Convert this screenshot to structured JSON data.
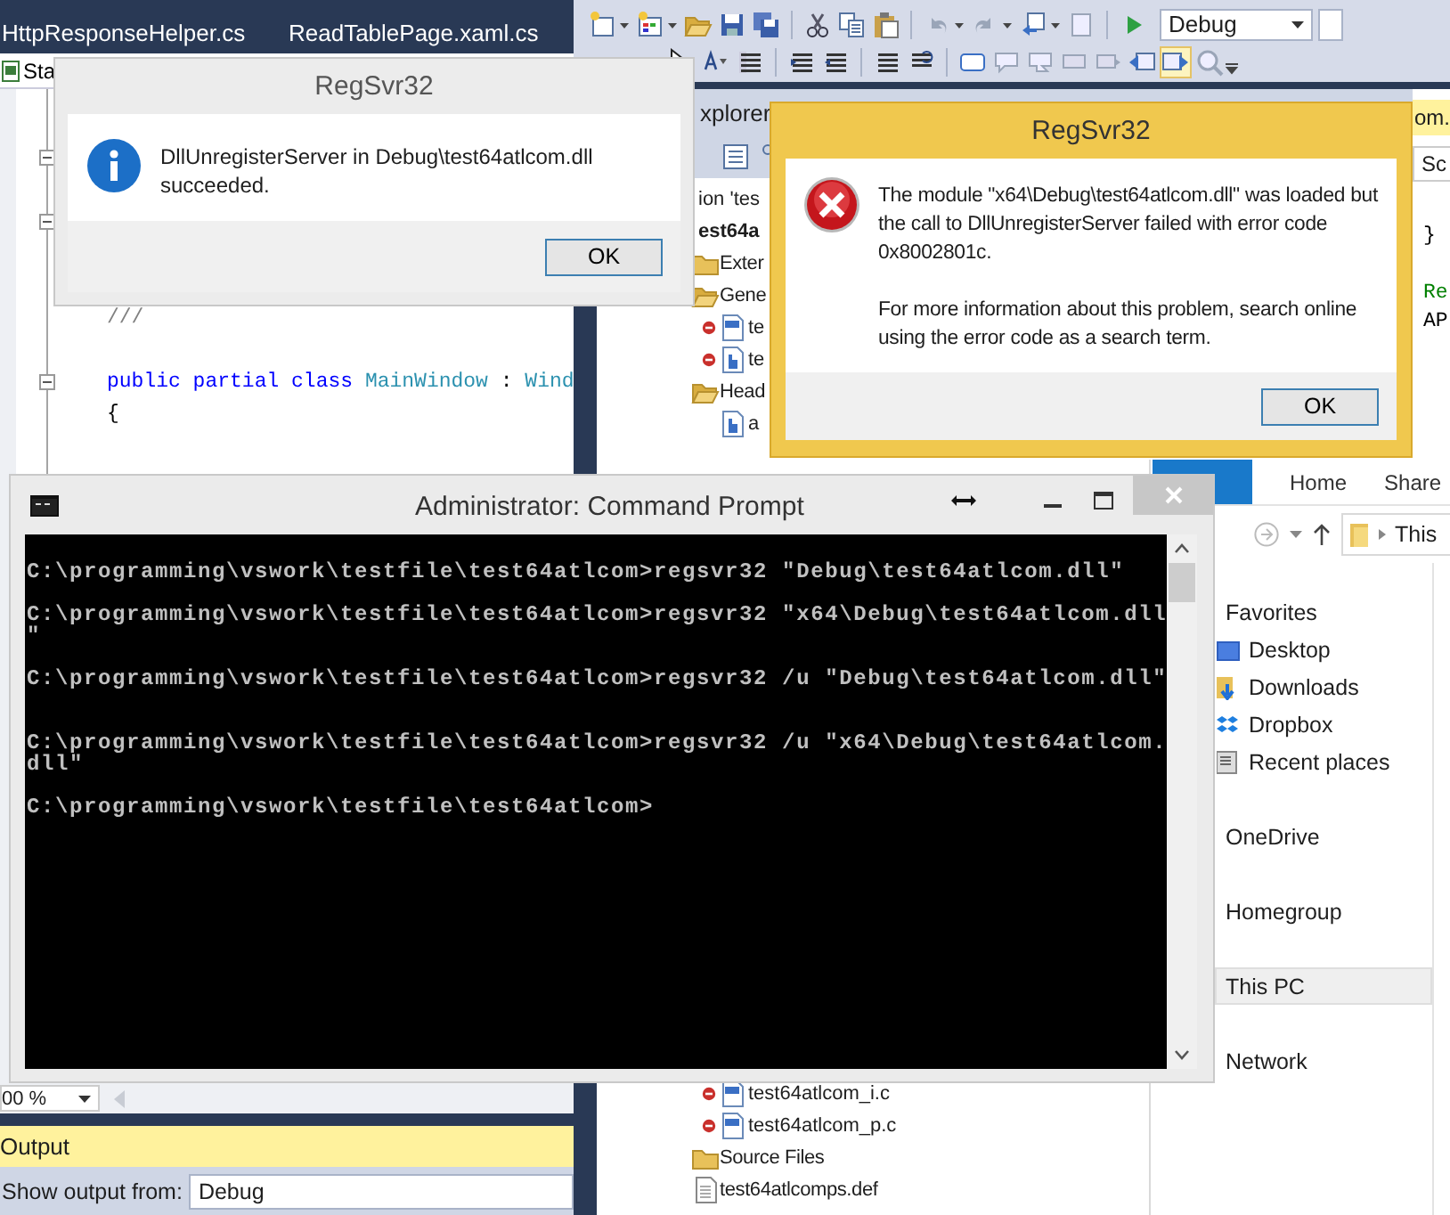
{
  "ide": {
    "editor_tabs": [
      {
        "label": "HttpResponseHelper.cs",
        "selected": false
      },
      {
        "label": "ReadTablePage.xaml.cs",
        "selected": false
      }
    ],
    "type_dropdown": {
      "value": "Sta"
    },
    "code_lines": [
      {
        "kind": "blank",
        "collapsible": false
      },
      {
        "kind": "blank",
        "collapsible": true
      },
      {
        "kind": "blank",
        "collapsible": false
      },
      {
        "kind": "blank",
        "collapsible": true
      },
      {
        "kind": "blank",
        "collapsible": false
      },
      {
        "kind": "blank",
        "collapsible": false
      },
      {
        "kind": "code",
        "collapsible": false,
        "tokens": [
          {
            "text": "///",
            "kind": "comment"
          }
        ]
      },
      {
        "kind": "blank",
        "collapsible": false
      },
      {
        "kind": "code",
        "collapsible": true,
        "tokens": [
          {
            "text": "public partial class ",
            "kind": "keyword"
          },
          {
            "text": "MainWindow",
            "kind": "type"
          },
          {
            "text": " : ",
            "kind": "plain"
          },
          {
            "text": "Wind",
            "kind": "type"
          }
        ]
      },
      {
        "kind": "code",
        "collapsible": false,
        "tokens": [
          {
            "text": "{",
            "kind": "plain"
          }
        ]
      }
    ],
    "configuration_dropdown": {
      "value": "Debug"
    },
    "solution_explorer": {
      "title": "xplorer",
      "tree": [
        {
          "label": "ion 'tes",
          "children": [
            {
              "label": "est64a",
              "kind": "project",
              "children": [
                {
                  "label": "Exter",
                  "kind": "folder",
                  "expanded": false
                },
                {
                  "label": "Gene",
                  "kind": "folder",
                  "expanded": true,
                  "children": [
                    {
                      "label": "te",
                      "kind": "cpp",
                      "excluded": true
                    },
                    {
                      "label": "te",
                      "kind": "header",
                      "excluded": true
                    }
                  ]
                },
                {
                  "label": "Head",
                  "kind": "folder",
                  "expanded": true,
                  "children": [
                    {
                      "label": "a",
                      "kind": "header",
                      "excluded": false
                    }
                  ]
                }
              ]
            }
          ]
        }
      ],
      "continued_items": [
        {
          "label": "test64atlcom_i.c",
          "kind": "cpp",
          "excluded": true
        },
        {
          "label": "test64atlcom_p.c",
          "kind": "cpp",
          "excluded": true
        },
        {
          "label": "Source Files",
          "kind": "folder",
          "expanded": false
        },
        {
          "label": "test64atlcomps.def",
          "kind": "file",
          "excluded": false
        }
      ]
    },
    "right_editor": {
      "tab": "om.",
      "dropdown": "Sc",
      "lines": [
        {
          "kind": "blank"
        },
        {
          "kind": "code",
          "text": "}"
        },
        {
          "kind": "blank"
        },
        {
          "kind": "comment",
          "text": "Re"
        },
        {
          "kind": "code",
          "text": "AP"
        }
      ]
    },
    "zoom_dropdown": {
      "value": "00 %"
    },
    "output": {
      "title": "Output",
      "source_label": "Show output from:",
      "source": "Debug"
    }
  },
  "explorer": {
    "ribbon_tabs": [
      {
        "label": "Home",
        "selected": false
      },
      {
        "label": "Share",
        "selected": false
      }
    ],
    "address": "This",
    "nav": [
      {
        "label": "Favorites",
        "selected": false,
        "children": [
          {
            "label": "Desktop",
            "kind": "desktop",
            "selected": false
          },
          {
            "label": "Downloads",
            "kind": "downloads",
            "selected": false
          },
          {
            "label": "Dropbox",
            "kind": "dropbox",
            "selected": false
          },
          {
            "label": "Recent places",
            "kind": "recent",
            "selected": false
          }
        ]
      },
      {
        "label": "OneDrive",
        "selected": false
      },
      {
        "label": "Homegroup",
        "selected": false
      },
      {
        "label": "This PC",
        "selected": true
      },
      {
        "label": "Network",
        "selected": false
      }
    ]
  },
  "command_prompt": {
    "title": "Administrator: Command Prompt",
    "lines": [
      {
        "kind": "text",
        "text": "C:\\programming\\vswork\\testfile\\test64atlcom>regsvr32 \"Debug\\test64atlcom.dll\""
      },
      {
        "kind": "blank"
      },
      {
        "kind": "text",
        "text": "C:\\programming\\vswork\\testfile\\test64atlcom>regsvr32 \"x64\\Debug\\test64atlcom.dll"
      },
      {
        "kind": "text",
        "text": "\""
      },
      {
        "kind": "blank"
      },
      {
        "kind": "text",
        "text": "C:\\programming\\vswork\\testfile\\test64atlcom>regsvr32 /u \"Debug\\test64atlcom.dll\""
      },
      {
        "kind": "blank"
      },
      {
        "kind": "blank"
      },
      {
        "kind": "text",
        "text": "C:\\programming\\vswork\\testfile\\test64atlcom>regsvr32 /u \"x64\\Debug\\test64atlcom."
      },
      {
        "kind": "text",
        "text": "dll\""
      },
      {
        "kind": "blank"
      },
      {
        "kind": "text",
        "text": "C:\\programming\\vswork\\testfile\\test64atlcom>"
      }
    ]
  },
  "dialogs": [
    {
      "title": "RegSvr32",
      "active": false,
      "kind": "information",
      "paragraphs": [
        "DllUnregisterServer in Debug\\test64atlcom.dll succeeded."
      ],
      "button": "OK"
    },
    {
      "title": "RegSvr32",
      "active": true,
      "kind": "error",
      "paragraphs": [
        "The module \"x64\\Debug\\test64atlcom.dll\" was loaded but the call to DllUnregisterServer failed with error code 0x8002801c.",
        "For more information about this problem, search online using the error code as a search term."
      ],
      "button": "OK"
    }
  ]
}
